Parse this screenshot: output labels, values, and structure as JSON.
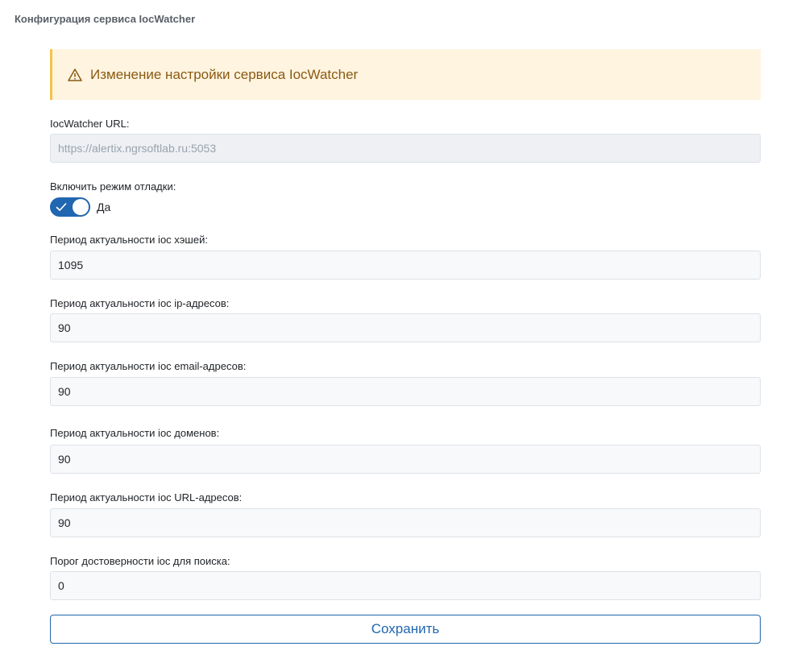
{
  "page": {
    "title": "Конфигурация сервиса IocWatcher"
  },
  "alert": {
    "text": "Изменение настройки сервиса IocWatcher",
    "icon": "warning-triangle-icon"
  },
  "url_field": {
    "label": "IocWatcher URL:",
    "value": "https://alertix.ngrsoftlab.ru:5053",
    "disabled": true
  },
  "debug": {
    "label": "Включить режим отладки:",
    "enabled": true,
    "state_text": "Да"
  },
  "fields": [
    {
      "label": "Период актуальности ioc хэшей:",
      "value": "1095"
    },
    {
      "label": "Период актуальности ioc ip-адресов:",
      "value": "90"
    },
    {
      "label": "Период актуальности ioc email-адресов:",
      "value": "90"
    },
    {
      "label": "Период актуальности ioc доменов:",
      "value": "90"
    },
    {
      "label": "Период актуальности ioc URL-адресов:",
      "value": "90"
    },
    {
      "label": "Порог достоверности ioc для поиска:",
      "value": "0"
    }
  ],
  "save_button": {
    "label": "Сохранить"
  },
  "colors": {
    "accent": "#2166b0",
    "alert_bg": "#fff4e0",
    "alert_border": "#f5c34a",
    "alert_text": "#8a5a12"
  }
}
